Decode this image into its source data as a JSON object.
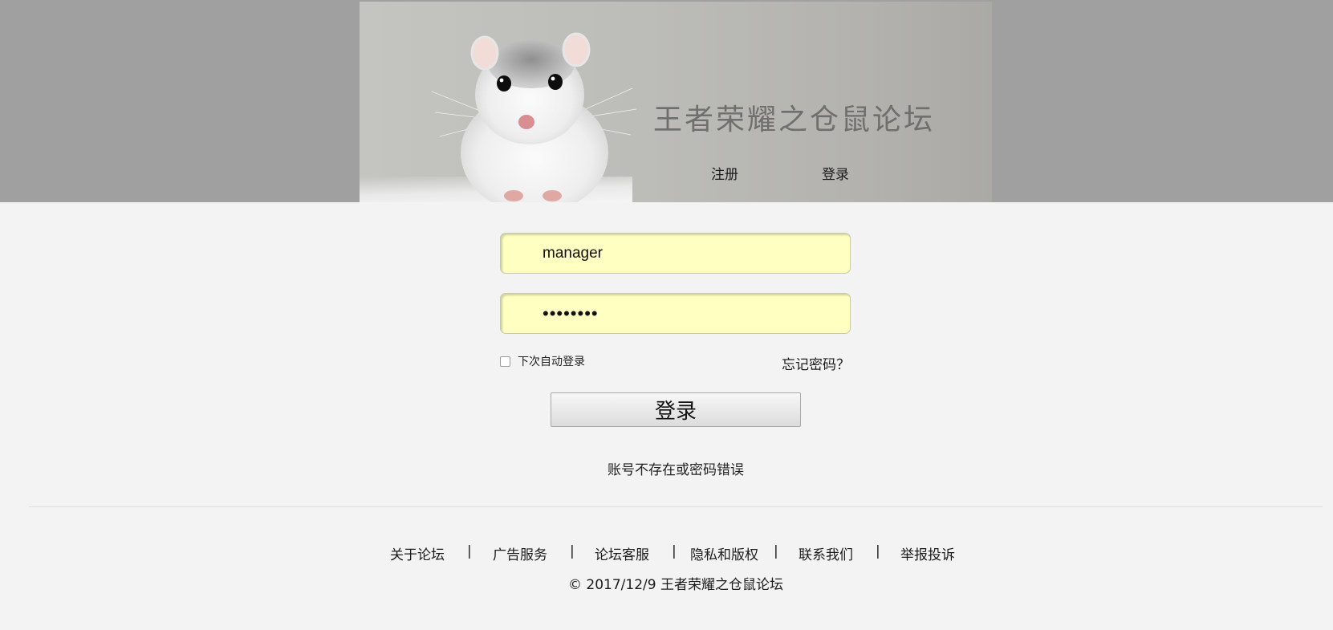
{
  "header": {
    "site_title": "王者荣耀之仓鼠论坛",
    "nav": {
      "register": "注册",
      "login": "登录"
    }
  },
  "login_form": {
    "username_value": "manager",
    "password_value": "••••••••",
    "remember_label": "下次自动登录",
    "remember_checked": false,
    "forgot_label": "忘记密码？",
    "submit_label": "登录",
    "error_message": "账号不存在或密码错误"
  },
  "footer": {
    "links": [
      "关于论坛",
      "广告服务",
      "论坛客服",
      "隐私和版权",
      "联系我们",
      "举报投诉"
    ],
    "separator": "|",
    "copyright": "© 2017/12/9 王者荣耀之仓鼠论坛"
  },
  "colors": {
    "header_band": "#a0a0a0",
    "page_background": "#f3f3f3",
    "input_background": "#feffc0"
  },
  "icons": {
    "banner_image": "hamster-image"
  }
}
